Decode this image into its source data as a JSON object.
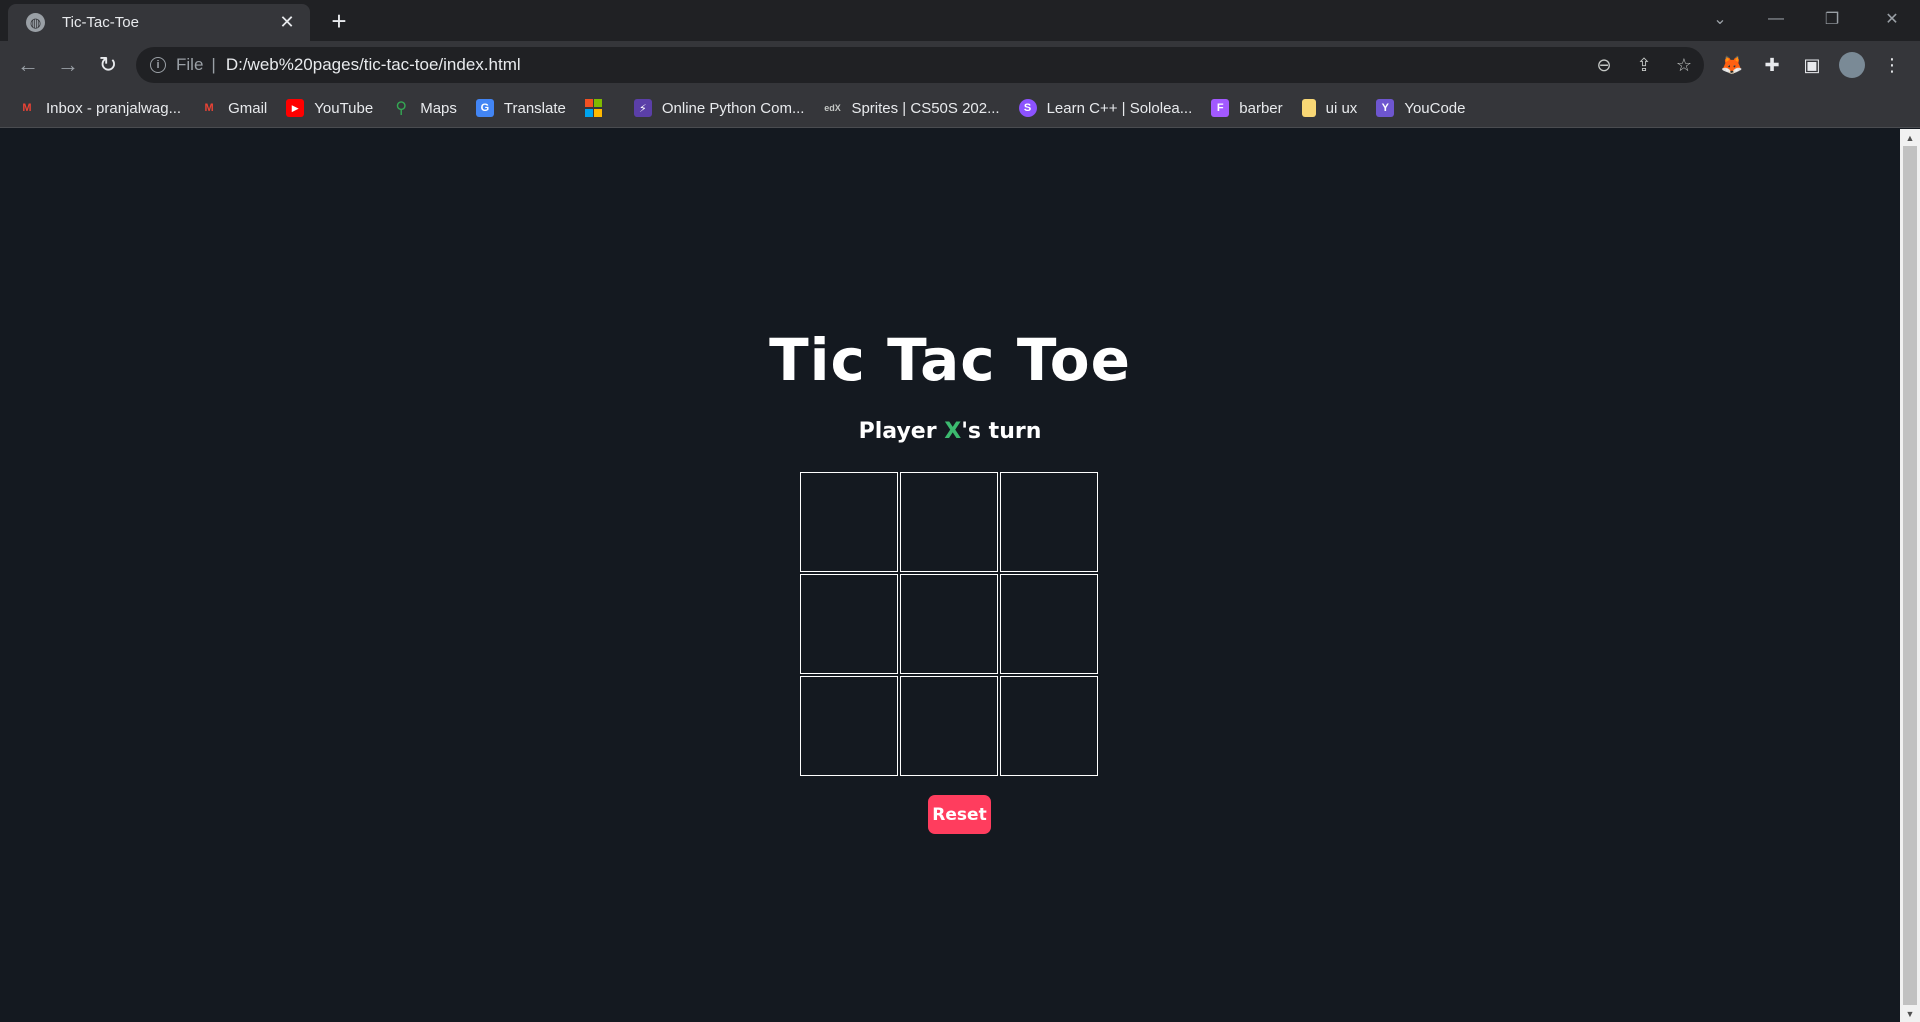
{
  "browser": {
    "tab": {
      "title": "Tic-Tac-Toe"
    },
    "omnibox": {
      "scheme_label": "File",
      "url": "D:/web%20pages/tic-tac-toe/index.html"
    },
    "bookmarks": [
      {
        "label": "Inbox - pranjalwag...",
        "icon": "gmail-icon",
        "color": "#ea4335",
        "glyph": "M"
      },
      {
        "label": "Gmail",
        "icon": "gmail-icon",
        "color": "#ea4335",
        "glyph": "M"
      },
      {
        "label": "YouTube",
        "icon": "youtube-icon",
        "color": "#ff0000",
        "glyph": "▶"
      },
      {
        "label": "Maps",
        "icon": "maps-icon",
        "color": "#34a853",
        "glyph": "●"
      },
      {
        "label": "Translate",
        "icon": "translate-icon",
        "color": "#4285f4",
        "glyph": "G"
      },
      {
        "label": "",
        "icon": "microsoft-icon",
        "color": "#f25022",
        "glyph": ""
      },
      {
        "label": "Online Python Com...",
        "icon": "bolt-icon",
        "color": "#5b3fa8",
        "glyph": "⚡"
      },
      {
        "label": "Sprites | CS50S 202...",
        "icon": "edx-icon",
        "color": "#35363a",
        "glyph": "edX"
      },
      {
        "label": "Learn C++ | Sololea...",
        "icon": "sololearn-icon",
        "color": "#8c52ff",
        "glyph": "S"
      },
      {
        "label": "barber",
        "icon": "figma-icon",
        "color": "#a259ff",
        "glyph": "F"
      },
      {
        "label": "ui ux",
        "icon": "folder-icon",
        "color": "#f8d775",
        "glyph": ""
      },
      {
        "label": "YouCode",
        "icon": "youcode-icon",
        "color": "#6e56cf",
        "glyph": "Y"
      }
    ]
  },
  "page": {
    "title": "Tic Tac Toe",
    "status_prefix": "Player ",
    "status_player": "X",
    "status_suffix": "'s turn",
    "board": [
      "",
      "",
      "",
      "",
      "",
      "",
      "",
      "",
      ""
    ],
    "reset_label": "Reset",
    "colors": {
      "background": "#141920",
      "player_x": "#3cba6f",
      "reset": "#ff3d5e"
    }
  }
}
